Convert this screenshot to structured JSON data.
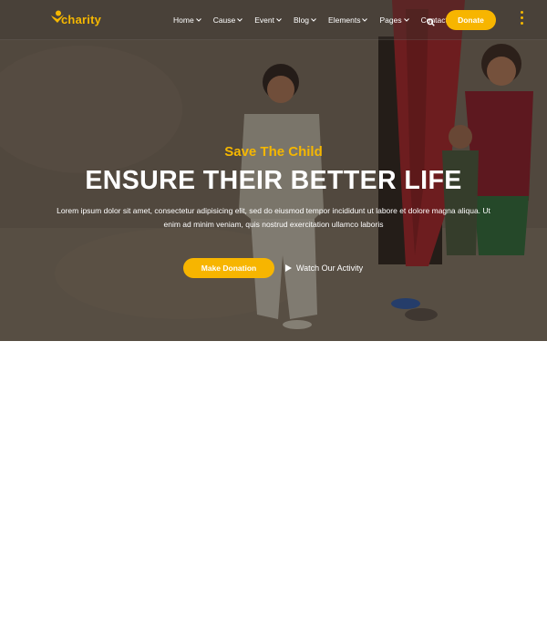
{
  "brand": {
    "name": "charity",
    "accent": "#f7b500"
  },
  "nav": {
    "items": [
      {
        "label": "Home",
        "has_dropdown": true
      },
      {
        "label": "Cause",
        "has_dropdown": true
      },
      {
        "label": "Event",
        "has_dropdown": true
      },
      {
        "label": "Blog",
        "has_dropdown": true
      },
      {
        "label": "Elements",
        "has_dropdown": true
      },
      {
        "label": "Pages",
        "has_dropdown": true
      },
      {
        "label": "Contact",
        "has_dropdown": false
      }
    ],
    "search_icon": "search-icon",
    "donate_label": "Donate",
    "more_icon": "vertical-dots-icon"
  },
  "hero": {
    "subtitle": "Save The Child",
    "title": "ENSURE THEIR BETTER LIFE",
    "description": "Lorem ipsum dolor sit amet, consectetur adipisicing elit, sed do eiusmod tempor incididunt ut labore et dolore magna aliqua. Ut enim ad minim veniam, quis nostrud exercitation ullamco laboris",
    "primary_button": "Make Donation",
    "secondary_link": "Watch Our Activity"
  }
}
